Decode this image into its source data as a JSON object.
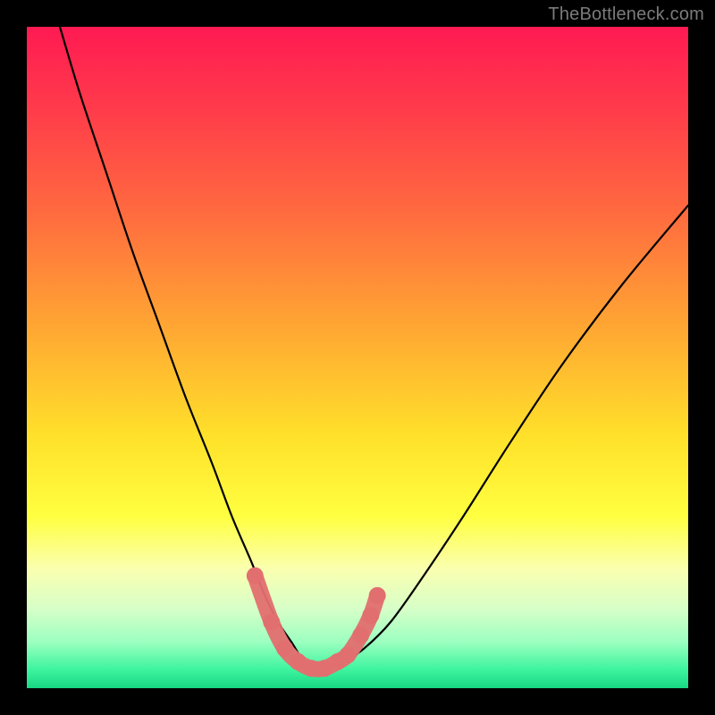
{
  "watermark": "TheBottleneck.com",
  "colors": {
    "frame": "#000000",
    "curve": "#000000",
    "marker": "#e26f6f",
    "gradient_stops": [
      {
        "offset": 0.0,
        "color": "#ff1a52"
      },
      {
        "offset": 0.12,
        "color": "#ff3a4b"
      },
      {
        "offset": 0.28,
        "color": "#ff6a3f"
      },
      {
        "offset": 0.45,
        "color": "#ffa533"
      },
      {
        "offset": 0.62,
        "color": "#ffe12a"
      },
      {
        "offset": 0.74,
        "color": "#ffff40"
      },
      {
        "offset": 0.82,
        "color": "#faffb0"
      },
      {
        "offset": 0.88,
        "color": "#d7ffc8"
      },
      {
        "offset": 0.93,
        "color": "#9cffc0"
      },
      {
        "offset": 0.97,
        "color": "#40f5a0"
      },
      {
        "offset": 1.0,
        "color": "#18d884"
      }
    ]
  },
  "chart_data": {
    "type": "line",
    "title": "",
    "xlabel": "",
    "ylabel": "",
    "xlim": [
      0,
      100
    ],
    "ylim": [
      0,
      100
    ],
    "grid": false,
    "series": [
      {
        "name": "bottleneck-curve",
        "x": [
          5,
          8,
          12,
          16,
          20,
          24,
          28,
          31,
          34,
          36,
          38,
          40,
          42,
          44,
          46,
          48,
          51,
          55,
          60,
          66,
          73,
          81,
          90,
          100
        ],
        "y": [
          100,
          90,
          78,
          66,
          55,
          44,
          34,
          26,
          19,
          14,
          10,
          7,
          4,
          3,
          3,
          4,
          6,
          10,
          17,
          26,
          37,
          49,
          61,
          73
        ]
      }
    ],
    "markers": {
      "name": "highlighted-points",
      "x": [
        34.5,
        37,
        39,
        41,
        43,
        45,
        47,
        48.5,
        50.5,
        52,
        53
      ],
      "y": [
        17,
        10,
        6,
        4,
        3,
        3,
        4,
        5,
        8,
        11,
        14
      ]
    }
  }
}
